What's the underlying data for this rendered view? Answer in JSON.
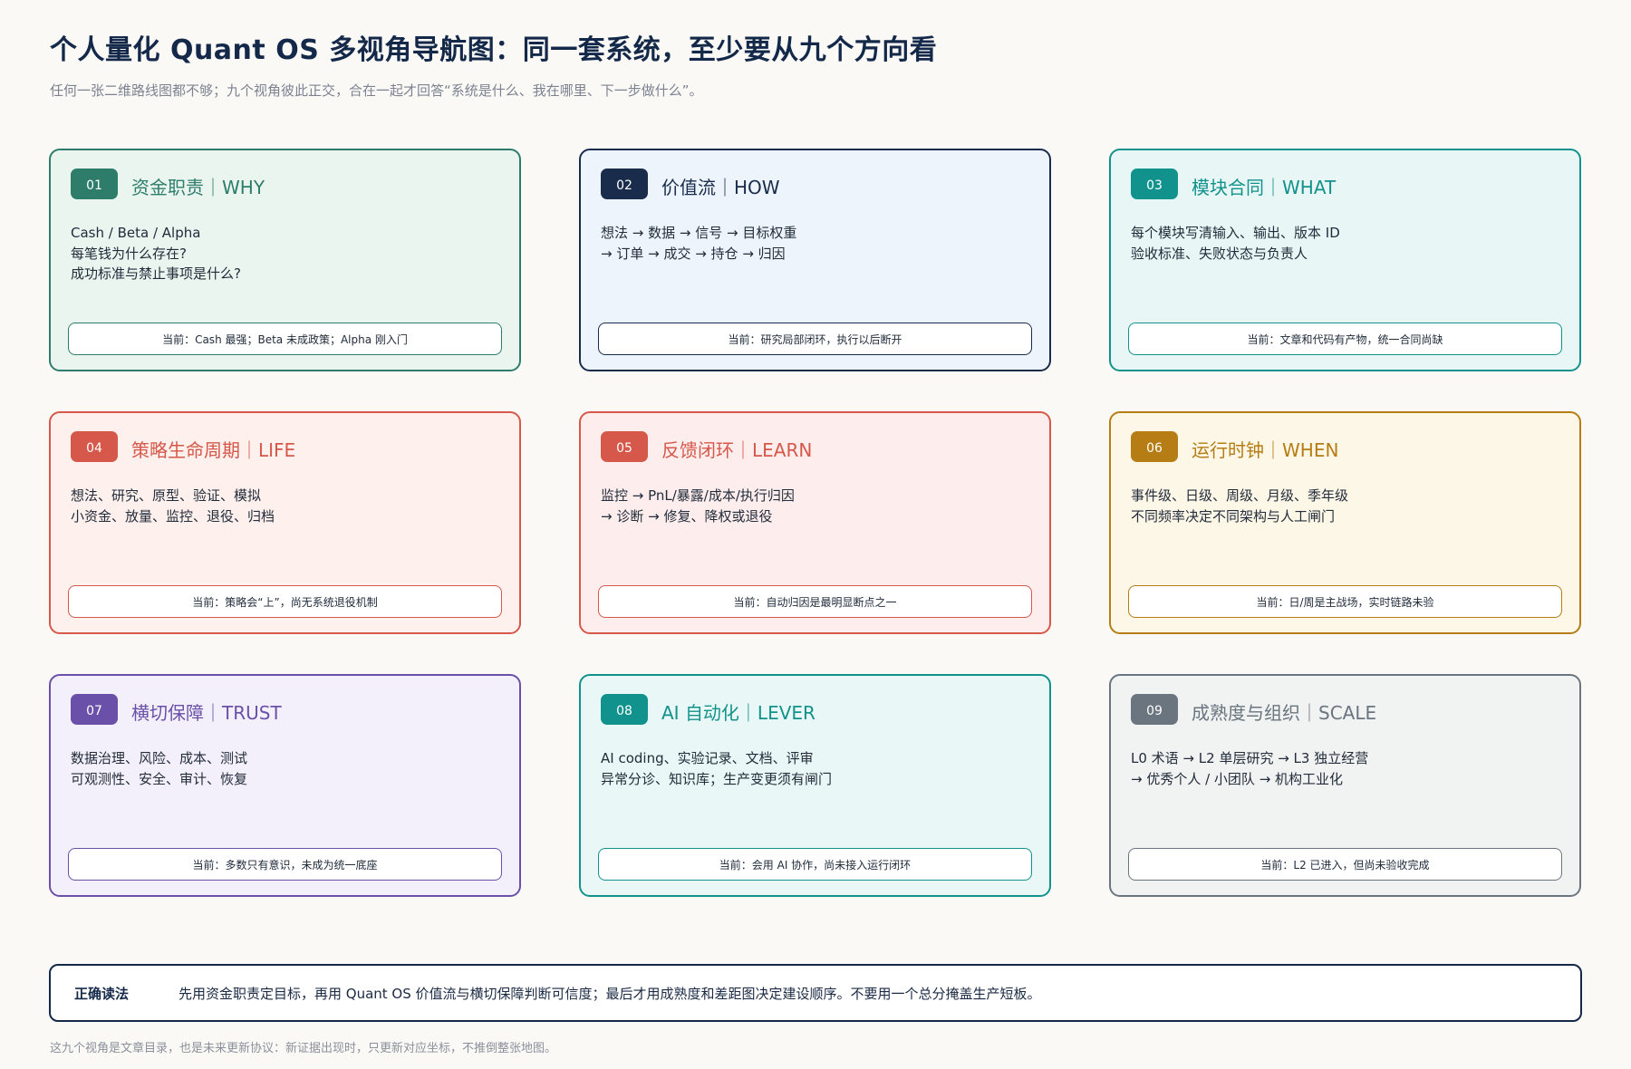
{
  "header": {
    "title": "个人量化 Quant OS 多视角导航图：同一套系统，至少要从九个方向看",
    "subtitle": "任何一张二维路线图都不够；九个视角彼此正交，合在一起才回答“系统是什么、我在哪里、下一步做什么”。"
  },
  "cards": [
    {
      "id": "01",
      "title": "资金职责｜WHY",
      "lines": [
        "Cash / Beta / Alpha",
        "每笔钱为什么存在?",
        "成功标准与禁止事项是什么?"
      ],
      "status": "当前：Cash 最强；Beta 未成政策；Alpha 刚入门",
      "accent": "#2e7d6a",
      "bg": "#eaf5f0",
      "title_color": "#2e7d6a"
    },
    {
      "id": "02",
      "title": "价值流｜HOW",
      "lines": [
        "想法 → 数据 → 信号 → 目标权重",
        "→ 订单 → 成交 → 持仓 → 归因"
      ],
      "status": "当前：研究局部闭环，执行以后断开",
      "accent": "#1a2c4c",
      "bg": "#edf4fc",
      "title_color": "#1a2c4c"
    },
    {
      "id": "03",
      "title": "模块合同｜WHAT",
      "lines": [
        "每个模块写清输入、输出、版本 ID",
        "验收标准、失败状态与负责人"
      ],
      "status": "当前：文章和代码有产物，统一合同尚缺",
      "accent": "#12928c",
      "bg": "#e8f7f6",
      "title_color": "#12928c"
    },
    {
      "id": "04",
      "title": "策略生命周期｜LIFE",
      "lines": [
        "想法、研究、原型、验证、模拟",
        "小资金、放量、监控、退役、归档"
      ],
      "status": "当前：策略会“上”，尚无系统退役机制",
      "accent": "#d5584a",
      "bg": "#fdf0ed",
      "title_color": "#d5584a"
    },
    {
      "id": "05",
      "title": "反馈闭环｜LEARN",
      "lines": [
        "监控 → PnL/暴露/成本/执行归因",
        "→ 诊断 → 修复、降权或退役"
      ],
      "status": "当前：自动归因是最明显断点之一",
      "accent": "#d5584a",
      "bg": "#fdeeed",
      "title_color": "#d5584a"
    },
    {
      "id": "06",
      "title": "运行时钟｜WHEN",
      "lines": [
        "事件级、日级、周级、月级、季年级",
        "不同频率决定不同架构与人工闸门"
      ],
      "status": "当前：日/周是主战场，实时链路未验",
      "accent": "#b57d14",
      "bg": "#fdf7e8",
      "title_color": "#b57d14"
    },
    {
      "id": "07",
      "title": "横切保障｜TRUST",
      "lines": [
        "数据治理、风险、成本、测试",
        "可观测性、安全、审计、恢复"
      ],
      "status": "当前：多数只有意识，未成为统一底座",
      "accent": "#6a50a8",
      "bg": "#f4f0fb",
      "title_color": "#6a50a8"
    },
    {
      "id": "08",
      "title": "AI 自动化｜LEVER",
      "lines": [
        "AI coding、实验记录、文档、评审",
        "异常分诊、知识库；生产变更须有闸门"
      ],
      "status": "当前：会用 AI 协作，尚未接入运行闭环",
      "accent": "#12928c",
      "bg": "#e9f7f6",
      "title_color": "#12928c"
    },
    {
      "id": "09",
      "title": "成熟度与组织｜SCALE",
      "lines": [
        "L0 术语 → L2 单层研究 → L3 独立经营",
        "→ 优秀个人 / 小团队 → 机构工业化"
      ],
      "status": "当前：L2 已进入，但尚未验收完成",
      "accent": "#6a757f",
      "bg": "#f1f2f2",
      "title_color": "#6a757f"
    }
  ],
  "footer": {
    "label": "正确读法",
    "text": "先用资金职责定目标，再用 Quant OS 价值流与横切保障判断可信度；最后才用成熟度和差距图决定建设顺序。不要用一个总分掩盖生产短板。"
  },
  "note": "这九个视角是文章目录，也是未来更新协议：新证据出现时，只更新对应坐标，不推倒整张地图。"
}
